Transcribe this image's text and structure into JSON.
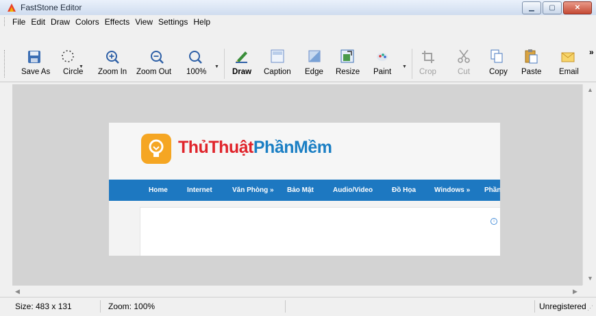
{
  "window": {
    "title": "FastStone Editor"
  },
  "menu": [
    "File",
    "Edit",
    "Draw",
    "Colors",
    "Effects",
    "View",
    "Settings",
    "Help"
  ],
  "toolbar": {
    "save_as": "Save As",
    "circle": "Circle",
    "zoom_in": "Zoom In",
    "zoom_out": "Zoom Out",
    "zoom_100": "100%",
    "draw": "Draw",
    "caption": "Caption",
    "edge": "Edge",
    "resize": "Resize",
    "paint": "Paint",
    "crop": "Crop",
    "cut": "Cut",
    "copy": "Copy",
    "paste": "Paste",
    "email": "Email",
    "overflow": "»"
  },
  "image": {
    "logo_part1": "Thủ",
    "logo_part2": "Thuật",
    "logo_part3": "PhầnMềm",
    "nav": [
      "Home",
      "Internet",
      "Văn Phòng »",
      "Bảo Mật",
      "Audio/Video",
      "Đồ Họa",
      "Windows »",
      "Phần"
    ]
  },
  "status": {
    "size": "Size: 483 x 131",
    "zoom": "Zoom: 100%",
    "registration": "Unregistered"
  },
  "colors": {
    "canvas": "#d3d3d3",
    "nav_blue": "#1d78c1",
    "logo_red": "#e0242b",
    "logo_blue": "#1b7fc4",
    "bulb": "#f5a623"
  }
}
